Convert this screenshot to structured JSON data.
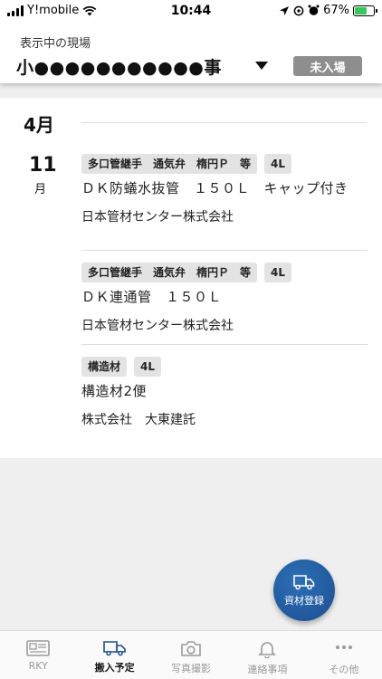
{
  "status_bar": {
    "carrier": "Y!mobile",
    "time": "10:44",
    "battery_percent": "67%",
    "battery_level": 0.67
  },
  "header": {
    "label": "表示中の現場",
    "site_name": "小●●●●●●●●●●●事",
    "entry_status": "未入場"
  },
  "list": {
    "month": "4月",
    "day": "11",
    "day_unit": "月",
    "entries": [
      {
        "tags": [
          "多口管継手　通気弁　楕円Ｐ　等",
          "4L"
        ],
        "item_name": "ＤＫ防蟻水抜管　１５０Ｌ　キャップ付き",
        "company": "日本管材センター株式会社"
      },
      {
        "tags": [
          "多口管継手　通気弁　楕円Ｐ　等",
          "4L"
        ],
        "item_name": "ＤＫ連通管　１５０Ｌ",
        "company": "日本管材センター株式会社"
      },
      {
        "tags": [
          "構造材",
          "4L"
        ],
        "item_name": "構造材2便",
        "company": "株式会社　大東建託"
      }
    ]
  },
  "fab": {
    "label": "資材登録",
    "icon": "truck-icon"
  },
  "tabs": [
    {
      "label": "RKY",
      "icon": "newspaper-icon"
    },
    {
      "label": "搬入予定",
      "icon": "truck-icon",
      "active": true
    },
    {
      "label": "写真撮影",
      "icon": "camera-icon"
    },
    {
      "label": "連絡事項",
      "icon": "bell-icon"
    },
    {
      "label": "その他",
      "icon": "more-icon"
    }
  ],
  "colors": {
    "accent": "#1d4f8f",
    "badge_gray": "#8e8e8e",
    "battery_green": "#34c759"
  }
}
